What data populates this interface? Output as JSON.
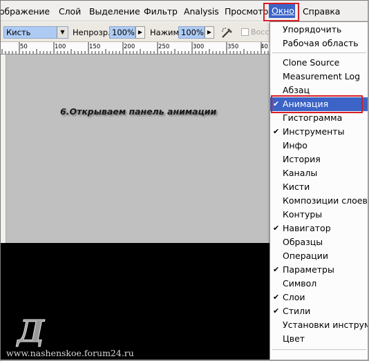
{
  "menubar": {
    "items": [
      "ображение",
      "Слой",
      "Выделение",
      "Фильтр",
      "Analysis",
      "Просмотр"
    ],
    "active": "Окно",
    "after": "Справка"
  },
  "options": {
    "tool_preset": "Кисть",
    "opacity_label": "Непрозр.:",
    "opacity_value": "100%",
    "flow_label": "Нажим:",
    "flow_value": "100%",
    "restore_label": "Восст"
  },
  "ruler": {
    "ticks": [
      "50",
      "100",
      "150",
      "200",
      "250",
      "300",
      "350",
      "40"
    ]
  },
  "canvas": {
    "caption": "6.Открываем панель анимации",
    "watermark": "www.nashenskoe.forum24.ru",
    "logo_letter": "Д"
  },
  "window_menu": {
    "items": [
      {
        "label": "Упорядочить",
        "checked": false
      },
      {
        "label": "Рабочая область",
        "checked": false
      },
      {
        "label": "Clone Source",
        "checked": false
      },
      {
        "label": "Measurement Log",
        "checked": false
      },
      {
        "label": "Абзац",
        "checked": false
      },
      {
        "label": "Анимация",
        "checked": true,
        "selected": true
      },
      {
        "label": "Гистограмма",
        "checked": false
      },
      {
        "label": "Инструменты",
        "checked": true
      },
      {
        "label": "Инфо",
        "checked": false
      },
      {
        "label": "История",
        "checked": false
      },
      {
        "label": "Каналы",
        "checked": false
      },
      {
        "label": "Кисти",
        "checked": false
      },
      {
        "label": "Композиции слоев",
        "checked": false
      },
      {
        "label": "Контуры",
        "checked": false
      },
      {
        "label": "Навигатор",
        "checked": true
      },
      {
        "label": "Образцы",
        "checked": false
      },
      {
        "label": "Операции",
        "checked": false
      },
      {
        "label": "Параметры",
        "checked": true
      },
      {
        "label": "Символ",
        "checked": false
      },
      {
        "label": "Слои",
        "checked": true
      },
      {
        "label": "Стили",
        "checked": true
      },
      {
        "label": "Установки инструме",
        "checked": false
      },
      {
        "label": "Цвет",
        "checked": false
      }
    ]
  },
  "colors": {
    "highlight_blue": "#3c64c7",
    "annotation_red": "#d81c23",
    "field_blue": "#aecbf4"
  }
}
